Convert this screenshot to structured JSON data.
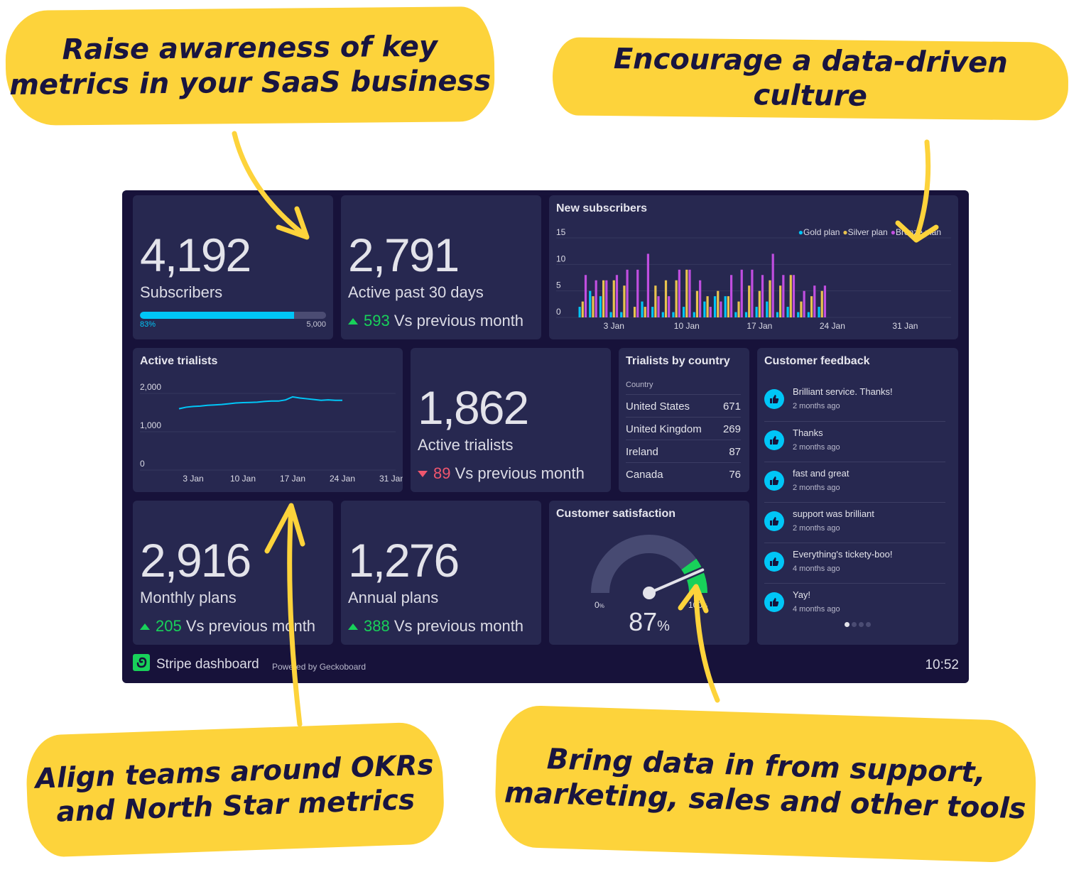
{
  "callouts": [
    {
      "line1": "Raise awareness of key",
      "line2": "metrics in your SaaS business"
    },
    {
      "line1": "Encourage a data-driven culture",
      "line2": ""
    },
    {
      "line1": "Align teams around OKRs",
      "line2": "and North Star metrics"
    },
    {
      "line1": "Bring data in from support,",
      "line2": "marketing, sales and other tools"
    }
  ],
  "colors": {
    "callout_yellow": "#fdd33b",
    "dashboard_bg": "#17123a",
    "tile_bg": "#272850",
    "gold_plan": "#00c6f7",
    "silver_plan": "#e8c34e",
    "bronze_plan": "#c04ee0",
    "positive": "#18d15a",
    "negative": "#f0566e"
  },
  "tiles": {
    "subscribers": {
      "value": "4,192",
      "label": "Subscribers",
      "progress_percent": 83,
      "progress_label": "83%",
      "goal_label": "5,000"
    },
    "active_past_30": {
      "value": "2,791",
      "label": "Active past 30 days",
      "delta": "593",
      "delta_direction": "up",
      "delta_text": "Vs previous month"
    },
    "active_trialists_number": {
      "value": "1,862",
      "label": "Active trialists",
      "delta": "89",
      "delta_direction": "down",
      "delta_text": "Vs previous month"
    },
    "monthly_plans": {
      "value": "2,916",
      "label": "Monthly plans",
      "delta": "205",
      "delta_direction": "up",
      "delta_text": "Vs previous month"
    },
    "annual_plans": {
      "value": "1,276",
      "label": "Annual plans",
      "delta": "388",
      "delta_direction": "up",
      "delta_text": "Vs previous month"
    },
    "trialists_by_country": {
      "title": "Trialists by country",
      "column_header": "Country",
      "rows": [
        {
          "country": "United States",
          "count": "671"
        },
        {
          "country": "United Kingdom",
          "count": "269"
        },
        {
          "country": "Ireland",
          "count": "87"
        },
        {
          "country": "Canada",
          "count": "76"
        }
      ]
    },
    "customer_feedback": {
      "title": "Customer feedback",
      "items": [
        {
          "text": "Brilliant service. Thanks!",
          "time": "2 months ago",
          "icon": "thumbs-up-icon"
        },
        {
          "text": "Thanks",
          "time": "2 months ago",
          "icon": "thumbs-up-icon"
        },
        {
          "text": "fast and great",
          "time": "2 months ago",
          "icon": "thumbs-up-icon"
        },
        {
          "text": "support was brilliant",
          "time": "2 months ago",
          "icon": "thumbs-up-icon"
        },
        {
          "text": "Everything's tickety-boo!",
          "time": "4 months ago",
          "icon": "thumbs-up-icon"
        },
        {
          "text": "Yay!",
          "time": "4 months ago",
          "icon": "thumbs-up-icon"
        }
      ],
      "pages": 4,
      "current_page": 1
    },
    "customer_satisfaction": {
      "title": "Customer satisfaction",
      "value": 87,
      "value_label": "87",
      "unit": "%",
      "min_label": "0",
      "max_label": "100",
      "min_unit": "%",
      "green_from": 80
    }
  },
  "footer": {
    "title": "Stripe dashboard",
    "powered_by": "Powered by Geckoboard",
    "time": "10:52"
  },
  "chart_data": [
    {
      "type": "bar",
      "title": "New subscribers",
      "ylim": [
        0,
        15
      ],
      "yticks": [
        "0",
        "5",
        "10",
        "15"
      ],
      "ytick_values": [
        0,
        5,
        10,
        15
      ],
      "xtick_labels": [
        "3 Jan",
        "10 Jan",
        "17 Jan",
        "24 Jan",
        "31 Jan"
      ],
      "xtick_day_index": [
        3,
        10,
        17,
        24,
        31
      ],
      "x_day_index_start": 0,
      "x_day_range": [
        -0.5,
        35
      ],
      "categories_day_index": [
        0,
        1,
        2,
        3,
        4,
        5,
        6,
        7,
        8,
        9,
        10,
        11,
        12,
        13,
        14,
        15,
        16,
        17,
        18,
        19,
        20,
        21,
        22,
        23
      ],
      "legend_position": "top-right",
      "series": [
        {
          "name": "Gold plan",
          "color": "#00c6f7",
          "values": [
            2,
            5,
            4,
            1,
            1,
            0,
            3,
            2,
            1,
            1,
            2,
            1,
            3,
            4,
            4,
            1,
            1,
            2,
            3,
            1,
            2,
            1,
            1,
            2
          ]
        },
        {
          "name": "Silver plan",
          "color": "#e8c34e",
          "values": [
            3,
            4,
            7,
            7,
            6,
            2,
            2,
            6,
            7,
            7,
            9,
            5,
            4,
            5,
            4,
            3,
            6,
            5,
            7,
            6,
            8,
            3,
            4,
            5
          ]
        },
        {
          "name": "Bronze plan",
          "color": "#c04ee0",
          "values": [
            8,
            7,
            7,
            8,
            9,
            9,
            12,
            4,
            4,
            9,
            9,
            7,
            2,
            3,
            8,
            9,
            9,
            8,
            12,
            8,
            8,
            5,
            6,
            6
          ]
        }
      ]
    },
    {
      "type": "line",
      "title": "Active trialists",
      "ylim": [
        0,
        2000
      ],
      "yticks": [
        "0",
        "1,000",
        "2,000"
      ],
      "ytick_values": [
        0,
        1000,
        2000
      ],
      "xtick_labels": [
        "3 Jan",
        "10 Jan",
        "17 Jan",
        "24 Jan",
        "31 Jan"
      ],
      "xtick_day_index": [
        3,
        10,
        17,
        24,
        31
      ],
      "x_day_range": [
        -3.5,
        31.5
      ],
      "series": [
        {
          "name": "Active trialists",
          "color": "#00c6f7",
          "x": [
            1,
            2,
            3,
            4,
            5,
            6,
            7,
            8,
            9,
            10,
            11,
            12,
            13,
            14,
            15,
            16,
            17,
            18,
            19,
            20,
            21,
            22,
            23,
            24
          ],
          "values": [
            1600,
            1640,
            1660,
            1670,
            1690,
            1700,
            1710,
            1730,
            1750,
            1760,
            1765,
            1770,
            1790,
            1800,
            1800,
            1830,
            1910,
            1880,
            1860,
            1840,
            1820,
            1830,
            1820,
            1820
          ]
        }
      ]
    }
  ]
}
